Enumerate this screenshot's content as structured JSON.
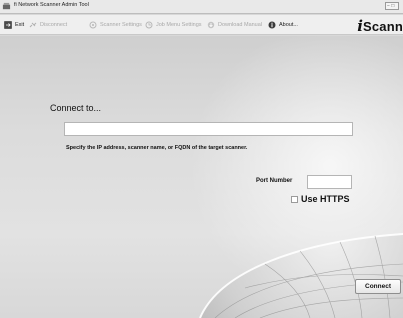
{
  "window": {
    "title": "fi Network Scanner Admin Tool",
    "icon": "scanner-app-icon",
    "controls": "− □"
  },
  "menubar": {
    "items": [
      {
        "label": "Exit",
        "icon": "exit-icon",
        "enabled": true
      },
      {
        "label": "Disconnect",
        "icon": "disconnect-icon",
        "enabled": false
      },
      {
        "label": "Scanner Settings",
        "icon": "scanner-settings-icon",
        "enabled": false
      },
      {
        "label": "Job Menu Settings",
        "icon": "job-menu-settings-icon",
        "enabled": false
      },
      {
        "label": "Download Manual",
        "icon": "download-manual-icon",
        "enabled": false
      },
      {
        "label": "About...",
        "icon": "about-icon",
        "enabled": true
      }
    ],
    "logo": {
      "first": "i",
      "rest": "Scann"
    }
  },
  "form": {
    "connect_label": "Connect to...",
    "host_value": "",
    "hint": "Specify the IP address, scanner name, or FQDN of the target scanner.",
    "port_label": "Port Number",
    "port_value": "",
    "https_label": "Use HTTPS",
    "https_checked": false,
    "connect_button": "Connect"
  },
  "colors": {
    "background": "#d8d8d8",
    "disabled_text": "#a8a8a8",
    "text": "#111111"
  }
}
